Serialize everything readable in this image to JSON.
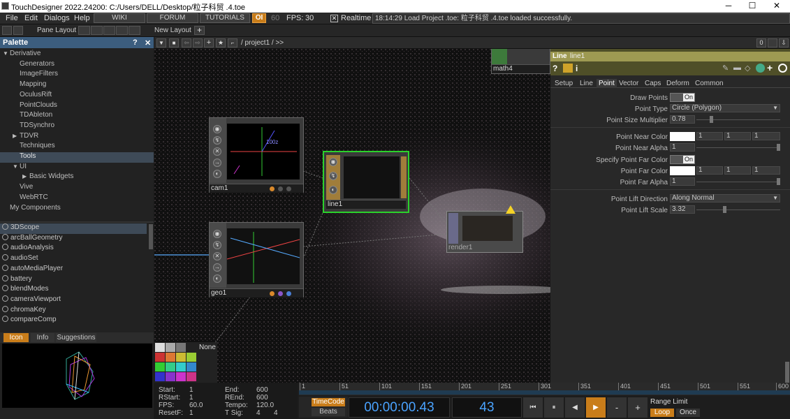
{
  "titlebar": {
    "title": "TouchDesigner 2022.24200: C:/Users/DELL/Desktop/粒子科贸 .4.toe",
    "min": "─",
    "max": "☐",
    "close": "✕"
  },
  "menubar": {
    "items": [
      "File",
      "Edit",
      "Dialogs",
      "Help"
    ],
    "buttons": [
      "WIKI",
      "FORUM",
      "TUTORIALS"
    ],
    "oi": "OI",
    "fps_value_box": "60",
    "fps_label": "FPS:",
    "fps_value": "30",
    "realtime": "Realtime",
    "status": "18:14:29 Load Project .toe: 粒子科贸 .4.toe loaded successfully."
  },
  "toolbar2": {
    "pane_layout": "Pane Layout",
    "new_layout": "New Layout",
    "add": "+"
  },
  "palette": {
    "title": "Palette",
    "help": "?",
    "close": "✕",
    "tree": [
      {
        "label": "Derivative",
        "indent": 0,
        "arrow": "▼"
      },
      {
        "label": "Generators",
        "indent": 1,
        "arrow": ""
      },
      {
        "label": "ImageFilters",
        "indent": 1,
        "arrow": ""
      },
      {
        "label": "Mapping",
        "indent": 1,
        "arrow": ""
      },
      {
        "label": "OculusRift",
        "indent": 1,
        "arrow": ""
      },
      {
        "label": "PointClouds",
        "indent": 1,
        "arrow": ""
      },
      {
        "label": "TDAbleton",
        "indent": 1,
        "arrow": ""
      },
      {
        "label": "TDSynchro",
        "indent": 1,
        "arrow": ""
      },
      {
        "label": "TDVR",
        "indent": 1,
        "arrow": "▶"
      },
      {
        "label": "Techniques",
        "indent": 1,
        "arrow": ""
      },
      {
        "label": "Tools",
        "indent": 1,
        "arrow": "",
        "selected": true
      },
      {
        "label": "UI",
        "indent": 1,
        "arrow": "▼"
      },
      {
        "label": "Basic Widgets",
        "indent": 2,
        "arrow": "▶"
      },
      {
        "label": "Vive",
        "indent": 1,
        "arrow": ""
      },
      {
        "label": "WebRTC",
        "indent": 1,
        "arrow": ""
      },
      {
        "label": "My Components",
        "indent": 0,
        "arrow": ""
      }
    ],
    "components": [
      "3DScope",
      "arcBallGeometry",
      "audioAnalysis",
      "audioSet",
      "autoMediaPlayer",
      "battery",
      "blendModes",
      "cameraViewport",
      "chromaKey",
      "compareComp"
    ],
    "info_tabs": [
      "Icon",
      "Info",
      "Suggestions"
    ]
  },
  "swatches": {
    "none": "None"
  },
  "network": {
    "path": "/ project1 / >>",
    "counter": "0",
    "nodes": {
      "cam1": "cam1",
      "geo1": "geo1",
      "line1": "line1",
      "render1": "render1",
      "math4": "math4"
    },
    "preview_label": "100z"
  },
  "params": {
    "op_type": "Line",
    "op_name": "line1",
    "tabs": [
      "Setup",
      "Line",
      "Point",
      "Vector",
      "Caps",
      "Deform",
      "Common"
    ],
    "active_tab": "Point",
    "rows": {
      "draw_points": {
        "label": "Draw Points",
        "value": "On"
      },
      "point_type": {
        "label": "Point Type",
        "value": "Circle (Polygon)"
      },
      "point_size": {
        "label": "Point Size Multiplier",
        "value": "0.78"
      },
      "near_color": {
        "label": "Point Near Color",
        "v1": "1",
        "v2": "1",
        "v3": "1"
      },
      "near_alpha": {
        "label": "Point Near Alpha",
        "value": "1"
      },
      "specify_far": {
        "label": "Specify Point Far Color",
        "value": "On"
      },
      "far_color": {
        "label": "Point Far Color",
        "v1": "1",
        "v2": "1",
        "v3": "1"
      },
      "far_alpha": {
        "label": "Point Far Alpha",
        "value": "1"
      },
      "lift_dir": {
        "label": "Point Lift Direction",
        "value": "Along Normal"
      },
      "lift_scale": {
        "label": "Point Lift Scale",
        "value": "3.32"
      }
    }
  },
  "timeline": {
    "start_label": "Start:",
    "start": "1",
    "rstart_label": "RStart:",
    "rstart": "1",
    "fps_label": "FPS:",
    "fps": "60.0",
    "resetf_label": "ResetF:",
    "resetf": "1",
    "end_label": "End:",
    "end": "600",
    "rend_label": "REnd:",
    "rend": "600",
    "tempo_label": "Tempo:",
    "tempo": "120.0",
    "tsig_label": "T Sig:",
    "tsig1": "4",
    "tsig2": "4",
    "ruler": [
      "1",
      "51",
      "101",
      "151",
      "201",
      "251",
      "301",
      "351",
      "401",
      "451",
      "501",
      "551",
      "600"
    ],
    "timecode_label": "TimeCode",
    "beats_label": "Beats",
    "timecode": "00:00:00.43",
    "frame": "43",
    "range_limit": "Range Limit",
    "loop": "Loop",
    "once": "Once",
    "minus": "-",
    "plus": "+"
  }
}
